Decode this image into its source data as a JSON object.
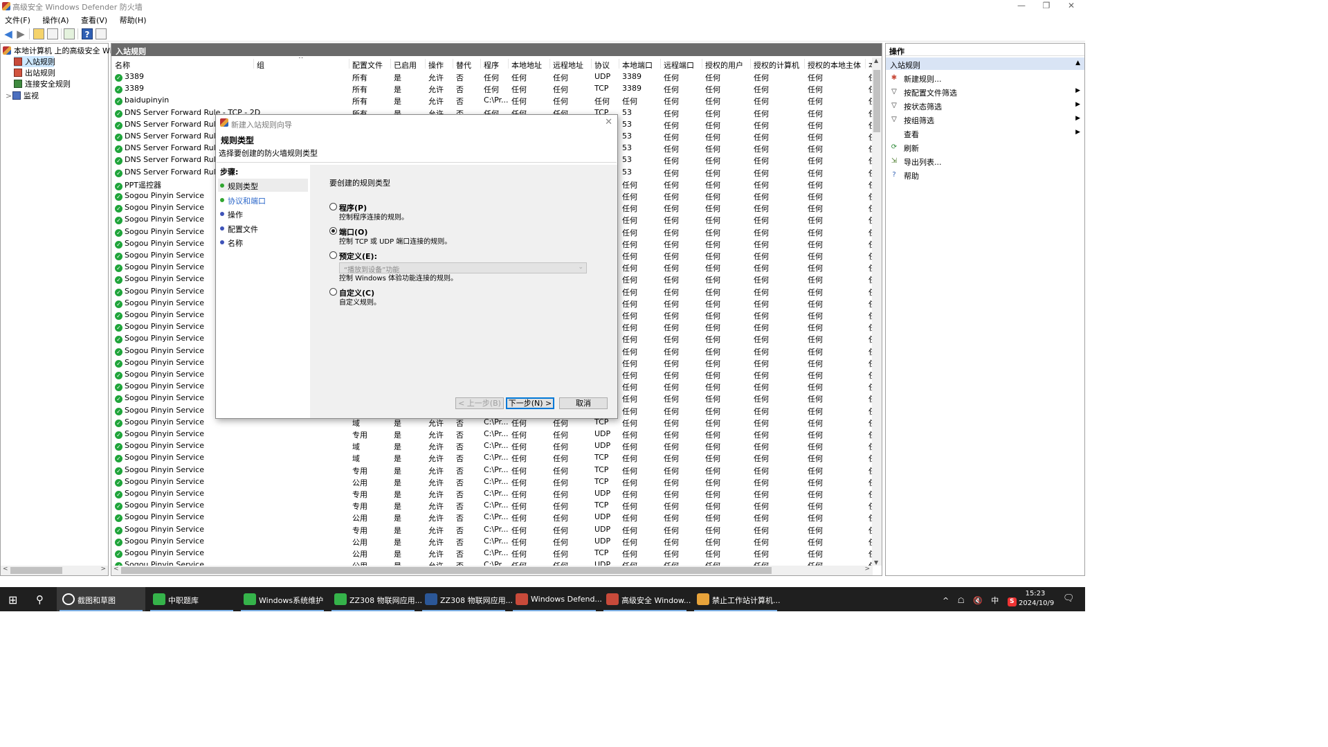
{
  "window": {
    "title": "高级安全 Windows Defender 防火墙",
    "controls": [
      "—",
      "❐",
      "✕"
    ]
  },
  "menu": [
    "文件(F)",
    "操作(A)",
    "查看(V)",
    "帮助(H)"
  ],
  "toolbar_icons": [
    "back-arrow-icon",
    "forward-arrow-icon",
    "up-folder-icon",
    "show-hide-tree-icon",
    "export-list-icon",
    "help-icon",
    "action-pane-icon"
  ],
  "tree": {
    "root": "本地计算机 上的高级安全 Windows Defender",
    "items": [
      "入站规则",
      "出站规则",
      "连接安全规则",
      "监视"
    ],
    "expander": ">"
  },
  "center": {
    "title": "入站规则",
    "sort_glyph": "^",
    "columns": [
      "名称",
      "组",
      "配置文件",
      "已启用",
      "操作",
      "替代",
      "程序",
      "本地地址",
      "远程地址",
      "协议",
      "本地端口",
      "远程端口",
      "授权的用户",
      "授权的计算机",
      "授权的本地主体",
      "本"
    ],
    "rows": [
      [
        "3389",
        "",
        "所有",
        "是",
        "允许",
        "否",
        "任何",
        "任何",
        "任何",
        "UDP",
        "3389",
        "任何",
        "任何",
        "任何",
        "任何",
        "任"
      ],
      [
        "3389",
        "",
        "所有",
        "是",
        "允许",
        "否",
        "任何",
        "任何",
        "任何",
        "TCP",
        "3389",
        "任何",
        "任何",
        "任何",
        "任何",
        "任"
      ],
      [
        "baidupinyin",
        "",
        "所有",
        "是",
        "允许",
        "否",
        "C:\\Pr...",
        "任何",
        "任何",
        "任何",
        "任何",
        "任何",
        "任何",
        "任何",
        "任何",
        "任"
      ],
      [
        "DNS Server Forward Rule - TCP - 2D",
        "",
        "所有",
        "是",
        "允许",
        "否",
        "任何",
        "任何",
        "任何",
        "TCP",
        "53",
        "任何",
        "任何",
        "任何",
        "任何",
        "任"
      ],
      [
        "DNS Server Forward Rule -",
        "",
        "",
        "",
        "",
        "",
        "",
        "",
        "",
        "",
        "53",
        "任何",
        "任何",
        "任何",
        "任何",
        "任"
      ],
      [
        "DNS Server Forward Rule -",
        "",
        "",
        "",
        "",
        "",
        "",
        "",
        "",
        "",
        "53",
        "任何",
        "任何",
        "任何",
        "任何",
        "任"
      ],
      [
        "DNS Server Forward Rule -",
        "",
        "",
        "",
        "",
        "",
        "",
        "",
        "",
        "",
        "53",
        "任何",
        "任何",
        "任何",
        "任何",
        "任"
      ],
      [
        "DNS Server Forward Rule -",
        "",
        "",
        "",
        "",
        "",
        "",
        "",
        "",
        "",
        "53",
        "任何",
        "任何",
        "任何",
        "任何",
        "任"
      ],
      [
        "DNS Server Forward Rule -",
        "",
        "",
        "",
        "",
        "",
        "",
        "",
        "",
        "",
        "53",
        "任何",
        "任何",
        "任何",
        "任何",
        "任"
      ],
      [
        "PPT遥控器",
        "",
        "",
        "",
        "",
        "",
        "",
        "",
        "",
        "",
        "任何",
        "任何",
        "任何",
        "任何",
        "任何",
        "任"
      ],
      [
        "Sogou Pinyin Service",
        "",
        "",
        "",
        "",
        "",
        "",
        "",
        "",
        "",
        "任何",
        "任何",
        "任何",
        "任何",
        "任何",
        "任"
      ],
      [
        "Sogou Pinyin Service",
        "",
        "",
        "",
        "",
        "",
        "",
        "",
        "",
        "",
        "任何",
        "任何",
        "任何",
        "任何",
        "任何",
        "任"
      ],
      [
        "Sogou Pinyin Service",
        "",
        "",
        "",
        "",
        "",
        "",
        "",
        "",
        "",
        "任何",
        "任何",
        "任何",
        "任何",
        "任何",
        "任"
      ],
      [
        "Sogou Pinyin Service",
        "",
        "",
        "",
        "",
        "",
        "",
        "",
        "",
        "",
        "任何",
        "任何",
        "任何",
        "任何",
        "任何",
        "任"
      ],
      [
        "Sogou Pinyin Service",
        "",
        "",
        "",
        "",
        "",
        "",
        "",
        "",
        "",
        "任何",
        "任何",
        "任何",
        "任何",
        "任何",
        "任"
      ],
      [
        "Sogou Pinyin Service",
        "",
        "",
        "",
        "",
        "",
        "",
        "",
        "",
        "",
        "任何",
        "任何",
        "任何",
        "任何",
        "任何",
        "任"
      ],
      [
        "Sogou Pinyin Service",
        "",
        "",
        "",
        "",
        "",
        "",
        "",
        "",
        "",
        "任何",
        "任何",
        "任何",
        "任何",
        "任何",
        "任"
      ],
      [
        "Sogou Pinyin Service",
        "",
        "",
        "",
        "",
        "",
        "",
        "",
        "",
        "",
        "任何",
        "任何",
        "任何",
        "任何",
        "任何",
        "任"
      ],
      [
        "Sogou Pinyin Service",
        "",
        "",
        "",
        "",
        "",
        "",
        "",
        "",
        "",
        "任何",
        "任何",
        "任何",
        "任何",
        "任何",
        "任"
      ],
      [
        "Sogou Pinyin Service",
        "",
        "",
        "",
        "",
        "",
        "",
        "",
        "",
        "",
        "任何",
        "任何",
        "任何",
        "任何",
        "任何",
        "任"
      ],
      [
        "Sogou Pinyin Service",
        "",
        "",
        "",
        "",
        "",
        "",
        "",
        "",
        "",
        "任何",
        "任何",
        "任何",
        "任何",
        "任何",
        "任"
      ],
      [
        "Sogou Pinyin Service",
        "",
        "",
        "",
        "",
        "",
        "",
        "",
        "",
        "",
        "任何",
        "任何",
        "任何",
        "任何",
        "任何",
        "任"
      ],
      [
        "Sogou Pinyin Service",
        "",
        "",
        "",
        "",
        "",
        "",
        "",
        "",
        "",
        "任何",
        "任何",
        "任何",
        "任何",
        "任何",
        "任"
      ],
      [
        "Sogou Pinyin Service",
        "",
        "",
        "",
        "",
        "",
        "",
        "",
        "",
        "",
        "任何",
        "任何",
        "任何",
        "任何",
        "任何",
        "任"
      ],
      [
        "Sogou Pinyin Service",
        "",
        "",
        "",
        "",
        "",
        "",
        "",
        "",
        "",
        "任何",
        "任何",
        "任何",
        "任何",
        "任何",
        "任"
      ],
      [
        "Sogou Pinyin Service",
        "",
        "",
        "",
        "",
        "",
        "",
        "",
        "",
        "",
        "任何",
        "任何",
        "任何",
        "任何",
        "任何",
        "任"
      ],
      [
        "Sogou Pinyin Service",
        "",
        "",
        "",
        "",
        "",
        "",
        "",
        "",
        "",
        "任何",
        "任何",
        "任何",
        "任何",
        "任何",
        "任"
      ],
      [
        "Sogou Pinyin Service",
        "",
        "",
        "",
        "",
        "",
        "",
        "",
        "",
        "",
        "任何",
        "任何",
        "任何",
        "任何",
        "任何",
        "任"
      ],
      [
        "Sogou Pinyin Service",
        "",
        "",
        "",
        "",
        "",
        "",
        "",
        "",
        "",
        "任何",
        "任何",
        "任何",
        "任何",
        "任何",
        "任"
      ],
      [
        "Sogou Pinyin Service",
        "",
        "域",
        "是",
        "允许",
        "否",
        "C:\\Pr...",
        "任何",
        "任何",
        "TCP",
        "任何",
        "任何",
        "任何",
        "任何",
        "任何",
        "任"
      ],
      [
        "Sogou Pinyin Service",
        "",
        "专用",
        "是",
        "允许",
        "否",
        "C:\\Pr...",
        "任何",
        "任何",
        "UDP",
        "任何",
        "任何",
        "任何",
        "任何",
        "任何",
        "任"
      ],
      [
        "Sogou Pinyin Service",
        "",
        "域",
        "是",
        "允许",
        "否",
        "C:\\Pr...",
        "任何",
        "任何",
        "UDP",
        "任何",
        "任何",
        "任何",
        "任何",
        "任何",
        "任"
      ],
      [
        "Sogou Pinyin Service",
        "",
        "域",
        "是",
        "允许",
        "否",
        "C:\\Pr...",
        "任何",
        "任何",
        "TCP",
        "任何",
        "任何",
        "任何",
        "任何",
        "任何",
        "任"
      ],
      [
        "Sogou Pinyin Service",
        "",
        "专用",
        "是",
        "允许",
        "否",
        "C:\\Pr...",
        "任何",
        "任何",
        "TCP",
        "任何",
        "任何",
        "任何",
        "任何",
        "任何",
        "任"
      ],
      [
        "Sogou Pinyin Service",
        "",
        "公用",
        "是",
        "允许",
        "否",
        "C:\\Pr...",
        "任何",
        "任何",
        "TCP",
        "任何",
        "任何",
        "任何",
        "任何",
        "任何",
        "任"
      ],
      [
        "Sogou Pinyin Service",
        "",
        "专用",
        "是",
        "允许",
        "否",
        "C:\\Pr...",
        "任何",
        "任何",
        "UDP",
        "任何",
        "任何",
        "任何",
        "任何",
        "任何",
        "任"
      ],
      [
        "Sogou Pinyin Service",
        "",
        "专用",
        "是",
        "允许",
        "否",
        "C:\\Pr...",
        "任何",
        "任何",
        "TCP",
        "任何",
        "任何",
        "任何",
        "任何",
        "任何",
        "任"
      ],
      [
        "Sogou Pinyin Service",
        "",
        "公用",
        "是",
        "允许",
        "否",
        "C:\\Pr...",
        "任何",
        "任何",
        "UDP",
        "任何",
        "任何",
        "任何",
        "任何",
        "任何",
        "任"
      ],
      [
        "Sogou Pinyin Service",
        "",
        "专用",
        "是",
        "允许",
        "否",
        "C:\\Pr...",
        "任何",
        "任何",
        "UDP",
        "任何",
        "任何",
        "任何",
        "任何",
        "任何",
        "任"
      ],
      [
        "Sogou Pinyin Service",
        "",
        "公用",
        "是",
        "允许",
        "否",
        "C:\\Pr...",
        "任何",
        "任何",
        "UDP",
        "任何",
        "任何",
        "任何",
        "任何",
        "任何",
        "任"
      ],
      [
        "Sogou Pinyin Service",
        "",
        "公用",
        "是",
        "允许",
        "否",
        "C:\\Pr...",
        "任何",
        "任何",
        "TCP",
        "任何",
        "任何",
        "任何",
        "任何",
        "任何",
        "任"
      ],
      [
        "Sogou Pinyin Service",
        "",
        "公用",
        "是",
        "允许",
        "否",
        "C:\\Pr...",
        "任何",
        "任何",
        "UDP",
        "任何",
        "任何",
        "任何",
        "任何",
        "任何",
        "任"
      ]
    ]
  },
  "actions": {
    "title": "操作",
    "section": "入站规则",
    "collapse_glyph": "▲",
    "items": [
      {
        "label": "新建规则...",
        "icon": "new-rule-icon",
        "glyph": "✱",
        "color": "#c84a3a",
        "submenu": false
      },
      {
        "label": "按配置文件筛选",
        "icon": "filter-icon",
        "glyph": "▽",
        "color": "#333333",
        "submenu": true
      },
      {
        "label": "按状态筛选",
        "icon": "filter-icon",
        "glyph": "▽",
        "color": "#333333",
        "submenu": true
      },
      {
        "label": "按组筛选",
        "icon": "filter-icon",
        "glyph": "▽",
        "color": "#333333",
        "submenu": true
      },
      {
        "label": "查看",
        "icon": "",
        "glyph": "",
        "color": "#333333",
        "submenu": true
      },
      {
        "label": "刷新",
        "icon": "refresh-icon",
        "glyph": "⟳",
        "color": "#2f8a3a",
        "submenu": false
      },
      {
        "label": "导出列表...",
        "icon": "export-icon",
        "glyph": "⇲",
        "color": "#4a7a2a",
        "submenu": false
      },
      {
        "label": "帮助",
        "icon": "help-icon",
        "glyph": "?",
        "color": "#2f5fb3",
        "submenu": false
      }
    ]
  },
  "dialog": {
    "title": "新建入站规则向导",
    "close_glyph": "✕",
    "heading": "规则类型",
    "subtitle": "选择要创建的防火墙规则类型",
    "steps_label": "步骤:",
    "steps": [
      {
        "label": "规则类型",
        "color": "#2fa52f",
        "state": "current"
      },
      {
        "label": "协议和端口",
        "color": "#2fa52f",
        "state": "link"
      },
      {
        "label": "操作",
        "color": "#3e53b8",
        "state": "normal"
      },
      {
        "label": "配置文件",
        "color": "#3e53b8",
        "state": "normal"
      },
      {
        "label": "名称",
        "color": "#3e53b8",
        "state": "normal"
      }
    ],
    "question": "要创建的规则类型",
    "options": [
      {
        "label": "程序(P)",
        "desc": "控制程序连接的规则。",
        "selected": false
      },
      {
        "label": "端口(O)",
        "desc": "控制 TCP 或 UDP 端口连接的规则。",
        "selected": true
      },
      {
        "label": "预定义(E):",
        "desc": "控制 Windows 体验功能连接的规则。",
        "selected": false
      },
      {
        "label": "自定义(C)",
        "desc": "自定义规则。",
        "selected": false
      }
    ],
    "predefined_value": "“播放到设备”功能",
    "predefined_arrow": "⌄",
    "buttons": {
      "back": "< 上一步(B)",
      "next": "下一步(N) >",
      "cancel": "取消"
    }
  },
  "taskbar": {
    "start_glyph": "⊞",
    "search_glyph": "⚲",
    "buttons": [
      {
        "label": "截图和草图",
        "color": "#ffffff"
      },
      {
        "label": "中职题库",
        "color": "#35b34a"
      },
      {
        "label": "Windows系统维护",
        "color": "#35b34a"
      },
      {
        "label": "ZZ308 物联网应用...",
        "color": "#35b34a"
      },
      {
        "label": "ZZ308 物联网应用...",
        "color": "#2b5797"
      },
      {
        "label": "Windows Defend...",
        "color": "#c84a3a"
      },
      {
        "label": "高级安全 Window...",
        "color": "#c84a3a"
      },
      {
        "label": "禁止工作站计算机...",
        "color": "#e8a33a"
      }
    ],
    "tray": [
      "^",
      "☖",
      "🔇",
      "中",
      "S"
    ],
    "time": "15:23",
    "date": "2024/10/9",
    "notify_glyph": "🗨"
  }
}
